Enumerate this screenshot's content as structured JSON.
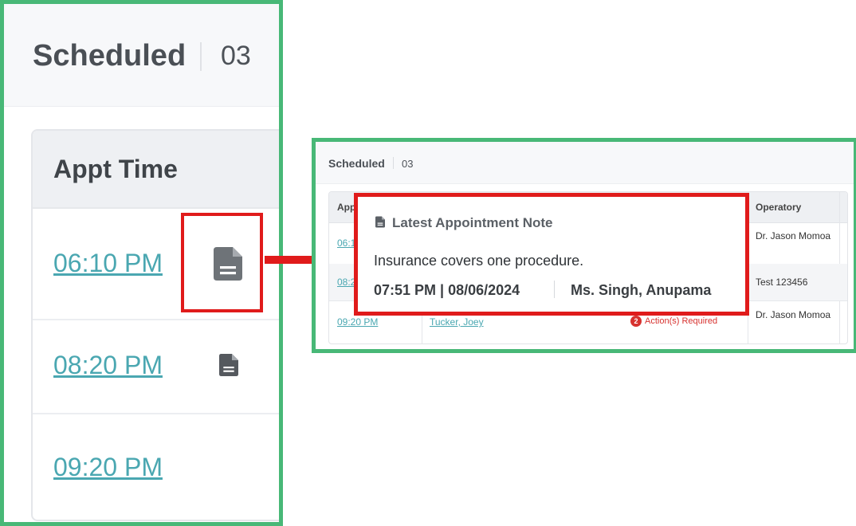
{
  "zoom": {
    "section_title": "Scheduled",
    "count": "03",
    "column_header": "Appt Time",
    "rows": [
      {
        "time": "06:10 PM",
        "has_note_icon": true
      },
      {
        "time": "08:20 PM",
        "has_note_icon": true
      },
      {
        "time": "09:20 PM",
        "has_note_icon": false
      }
    ],
    "note_icon": "document-icon"
  },
  "screenshot": {
    "section_title": "Scheduled",
    "count": "03",
    "columns": {
      "appt": "App",
      "operatory": "Operatory"
    },
    "rows": [
      {
        "time": "06:1",
        "patient": "",
        "action": "",
        "operatory": "Dr. Jason Momoa"
      },
      {
        "time": "08:2",
        "patient": "",
        "action": "",
        "operatory": "Test 123456"
      },
      {
        "time": "09:20 PM",
        "patient": "Tucker, Joey",
        "action_count": "2",
        "action": "Action(s) Required",
        "operatory": "Dr. Jason Momoa"
      }
    ]
  },
  "note_popover": {
    "title": "Latest Appointment Note",
    "body": "Insurance covers one procedure.",
    "timestamp": "07:51 PM | 08/06/2024",
    "author": "Ms. Singh, Anupama"
  },
  "colors": {
    "frame_green": "#48b877",
    "highlight_red": "#e01b1b",
    "link_teal": "#4aa7b1",
    "action_red": "#d7322f"
  }
}
